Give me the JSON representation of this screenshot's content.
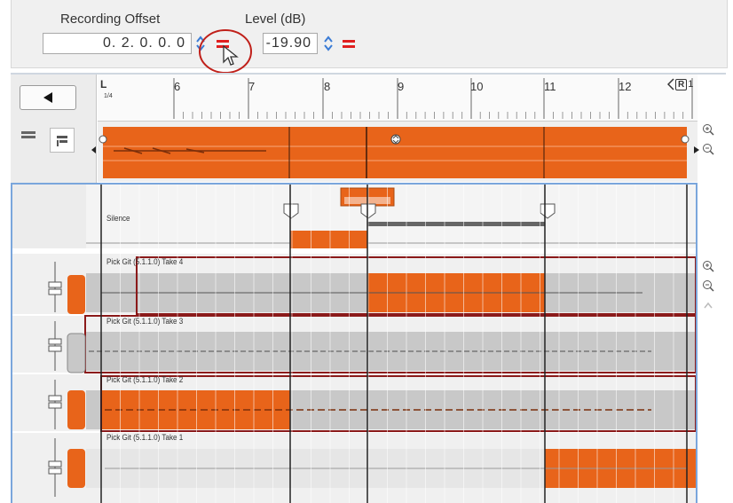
{
  "header": {
    "recording_offset_label": "Recording Offset",
    "recording_offset_value": "0. 2. 0.  0. 0",
    "level_label": "Level (dB)",
    "level_value": "-19.90"
  },
  "ruler": {
    "bars": [
      "6",
      "7",
      "8",
      "9",
      "10",
      "11",
      "12"
    ],
    "left_locator": "L",
    "left_locator_sub": "1/4",
    "right_locator": "R",
    "right_locator_trail": "1"
  },
  "comp": {
    "silence_label": "Silence",
    "takes": [
      {
        "label": "Pick Git (5.1.1.0) Take 4"
      },
      {
        "label": "Pick Git (5.1.1.0) Take 3"
      },
      {
        "label": "Pick Git (5.1.1.0) Take 2"
      },
      {
        "label": "Pick Git (5.1.1.0) Take 1"
      }
    ]
  },
  "colors": {
    "accent_orange": "#e8641a",
    "selection_border": "#8b1a1a",
    "highlight_red": "#e02020",
    "panel_blue_border": "#7aa6dc"
  },
  "icons": {
    "back": "triangle-left-icon",
    "zoom_in": "zoom-in-icon",
    "zoom_out": "zoom-out-icon",
    "offset_button": "red-equals-icon",
    "cursor": "mouse-cursor-icon"
  }
}
